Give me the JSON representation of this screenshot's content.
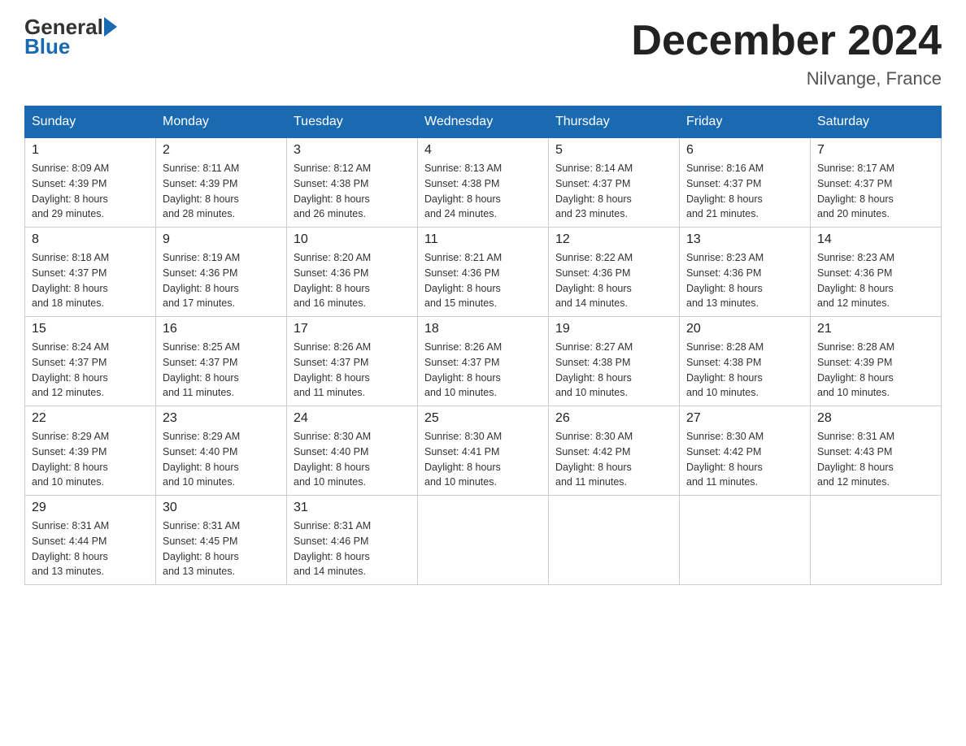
{
  "header": {
    "logo_general": "General",
    "logo_blue": "Blue",
    "month_title": "December 2024",
    "location": "Nilvange, France"
  },
  "days_of_week": [
    "Sunday",
    "Monday",
    "Tuesday",
    "Wednesday",
    "Thursday",
    "Friday",
    "Saturday"
  ],
  "weeks": [
    [
      {
        "day": "1",
        "sunrise": "8:09 AM",
        "sunset": "4:39 PM",
        "daylight": "8 hours and 29 minutes."
      },
      {
        "day": "2",
        "sunrise": "8:11 AM",
        "sunset": "4:39 PM",
        "daylight": "8 hours and 28 minutes."
      },
      {
        "day": "3",
        "sunrise": "8:12 AM",
        "sunset": "4:38 PM",
        "daylight": "8 hours and 26 minutes."
      },
      {
        "day": "4",
        "sunrise": "8:13 AM",
        "sunset": "4:38 PM",
        "daylight": "8 hours and 24 minutes."
      },
      {
        "day": "5",
        "sunrise": "8:14 AM",
        "sunset": "4:37 PM",
        "daylight": "8 hours and 23 minutes."
      },
      {
        "day": "6",
        "sunrise": "8:16 AM",
        "sunset": "4:37 PM",
        "daylight": "8 hours and 21 minutes."
      },
      {
        "day": "7",
        "sunrise": "8:17 AM",
        "sunset": "4:37 PM",
        "daylight": "8 hours and 20 minutes."
      }
    ],
    [
      {
        "day": "8",
        "sunrise": "8:18 AM",
        "sunset": "4:37 PM",
        "daylight": "8 hours and 18 minutes."
      },
      {
        "day": "9",
        "sunrise": "8:19 AM",
        "sunset": "4:36 PM",
        "daylight": "8 hours and 17 minutes."
      },
      {
        "day": "10",
        "sunrise": "8:20 AM",
        "sunset": "4:36 PM",
        "daylight": "8 hours and 16 minutes."
      },
      {
        "day": "11",
        "sunrise": "8:21 AM",
        "sunset": "4:36 PM",
        "daylight": "8 hours and 15 minutes."
      },
      {
        "day": "12",
        "sunrise": "8:22 AM",
        "sunset": "4:36 PM",
        "daylight": "8 hours and 14 minutes."
      },
      {
        "day": "13",
        "sunrise": "8:23 AM",
        "sunset": "4:36 PM",
        "daylight": "8 hours and 13 minutes."
      },
      {
        "day": "14",
        "sunrise": "8:23 AM",
        "sunset": "4:36 PM",
        "daylight": "8 hours and 12 minutes."
      }
    ],
    [
      {
        "day": "15",
        "sunrise": "8:24 AM",
        "sunset": "4:37 PM",
        "daylight": "8 hours and 12 minutes."
      },
      {
        "day": "16",
        "sunrise": "8:25 AM",
        "sunset": "4:37 PM",
        "daylight": "8 hours and 11 minutes."
      },
      {
        "day": "17",
        "sunrise": "8:26 AM",
        "sunset": "4:37 PM",
        "daylight": "8 hours and 11 minutes."
      },
      {
        "day": "18",
        "sunrise": "8:26 AM",
        "sunset": "4:37 PM",
        "daylight": "8 hours and 10 minutes."
      },
      {
        "day": "19",
        "sunrise": "8:27 AM",
        "sunset": "4:38 PM",
        "daylight": "8 hours and 10 minutes."
      },
      {
        "day": "20",
        "sunrise": "8:28 AM",
        "sunset": "4:38 PM",
        "daylight": "8 hours and 10 minutes."
      },
      {
        "day": "21",
        "sunrise": "8:28 AM",
        "sunset": "4:39 PM",
        "daylight": "8 hours and 10 minutes."
      }
    ],
    [
      {
        "day": "22",
        "sunrise": "8:29 AM",
        "sunset": "4:39 PM",
        "daylight": "8 hours and 10 minutes."
      },
      {
        "day": "23",
        "sunrise": "8:29 AM",
        "sunset": "4:40 PM",
        "daylight": "8 hours and 10 minutes."
      },
      {
        "day": "24",
        "sunrise": "8:30 AM",
        "sunset": "4:40 PM",
        "daylight": "8 hours and 10 minutes."
      },
      {
        "day": "25",
        "sunrise": "8:30 AM",
        "sunset": "4:41 PM",
        "daylight": "8 hours and 10 minutes."
      },
      {
        "day": "26",
        "sunrise": "8:30 AM",
        "sunset": "4:42 PM",
        "daylight": "8 hours and 11 minutes."
      },
      {
        "day": "27",
        "sunrise": "8:30 AM",
        "sunset": "4:42 PM",
        "daylight": "8 hours and 11 minutes."
      },
      {
        "day": "28",
        "sunrise": "8:31 AM",
        "sunset": "4:43 PM",
        "daylight": "8 hours and 12 minutes."
      }
    ],
    [
      {
        "day": "29",
        "sunrise": "8:31 AM",
        "sunset": "4:44 PM",
        "daylight": "8 hours and 13 minutes."
      },
      {
        "day": "30",
        "sunrise": "8:31 AM",
        "sunset": "4:45 PM",
        "daylight": "8 hours and 13 minutes."
      },
      {
        "day": "31",
        "sunrise": "8:31 AM",
        "sunset": "4:46 PM",
        "daylight": "8 hours and 14 minutes."
      },
      null,
      null,
      null,
      null
    ]
  ],
  "labels": {
    "sunrise": "Sunrise:",
    "sunset": "Sunset:",
    "daylight": "Daylight:"
  }
}
